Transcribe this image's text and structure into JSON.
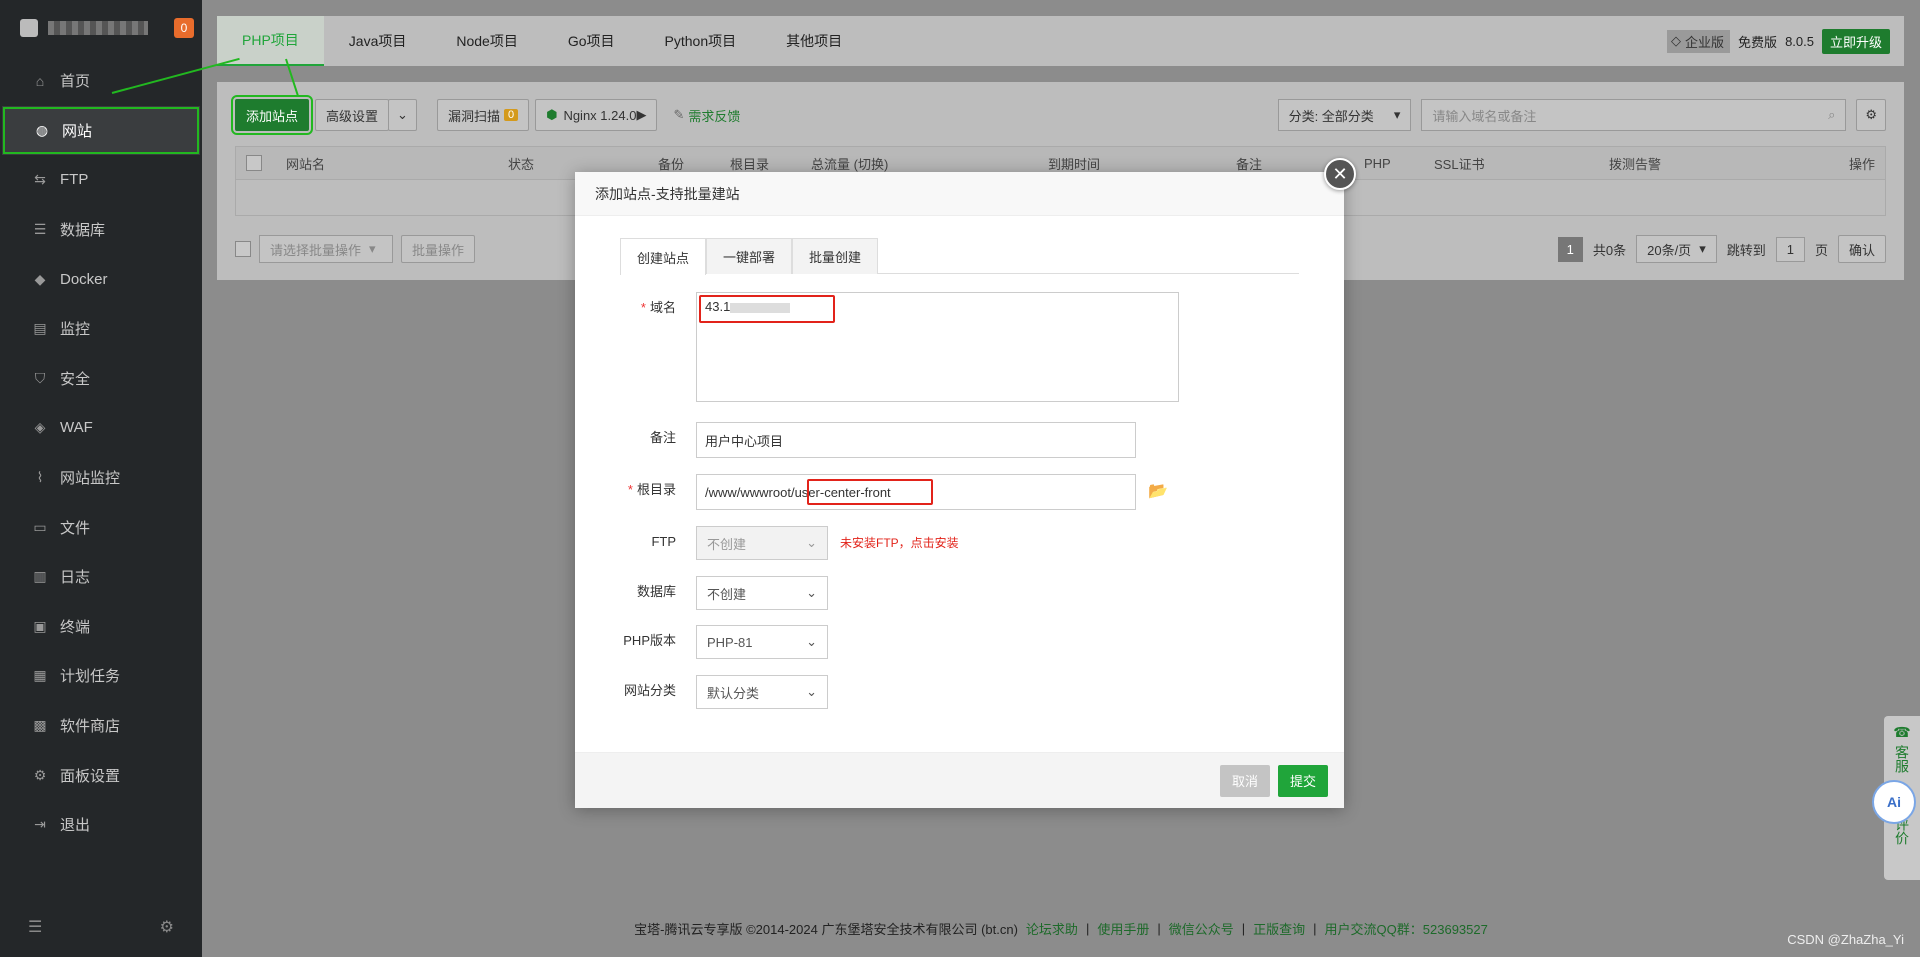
{
  "sidebar": {
    "badge": "0",
    "items": [
      {
        "label": "首页",
        "icon": "home-icon"
      },
      {
        "label": "网站",
        "icon": "globe-icon"
      },
      {
        "label": "FTP",
        "icon": "ftp-icon"
      },
      {
        "label": "数据库",
        "icon": "database-icon"
      },
      {
        "label": "Docker",
        "icon": "docker-icon"
      },
      {
        "label": "监控",
        "icon": "monitor-icon"
      },
      {
        "label": "安全",
        "icon": "shield-icon"
      },
      {
        "label": "WAF",
        "icon": "waf-icon"
      },
      {
        "label": "网站监控",
        "icon": "chart-icon"
      },
      {
        "label": "文件",
        "icon": "folder-icon"
      },
      {
        "label": "日志",
        "icon": "log-icon"
      },
      {
        "label": "终端",
        "icon": "terminal-icon"
      },
      {
        "label": "计划任务",
        "icon": "calendar-icon"
      },
      {
        "label": "软件商店",
        "icon": "apps-icon"
      },
      {
        "label": "面板设置",
        "icon": "gear-icon"
      },
      {
        "label": "退出",
        "icon": "logout-icon"
      }
    ]
  },
  "tabs": [
    "PHP项目",
    "Java项目",
    "Node项目",
    "Go项目",
    "Python项目",
    "其他项目"
  ],
  "header_right": {
    "enterprise": "企业版",
    "free": "免费版",
    "version": "8.0.5",
    "upgrade": "立即升级"
  },
  "toolbar": {
    "add_site": "添加站点",
    "advanced": "高级设置",
    "vuln_scan": "漏洞扫描",
    "vuln_count": "0",
    "nginx": "Nginx 1.24.0",
    "feedback": "需求反馈",
    "category": "分类: 全部分类",
    "search_placeholder": "请输入域名或备注"
  },
  "table": {
    "headers": [
      "网站名",
      "状态",
      "备份",
      "根目录",
      "总流量 (切换)",
      "到期时间",
      "备注",
      "PHP",
      "SSL证书",
      "拨测告警",
      "操作"
    ]
  },
  "pager": {
    "batch_placeholder": "请选择批量操作",
    "batch_btn": "批量操作",
    "page": "1",
    "total": "共0条",
    "per_page": "20条/页",
    "jump": "跳转到",
    "jump_value": "1",
    "page_unit": "页",
    "confirm": "确认"
  },
  "modal": {
    "title": "添加站点-支持批量建站",
    "tabs": [
      "创建站点",
      "一键部署",
      "批量创建"
    ],
    "domain_label": "域名",
    "domain_value": "43.1",
    "remark_label": "备注",
    "remark_value": "用户中心项目",
    "root_label": "根目录",
    "root_prefix": "/www/wwwroot/",
    "root_suffix": "user-center-front",
    "ftp_label": "FTP",
    "ftp_value": "不创建",
    "ftp_warn": "未安装FTP，点击安装",
    "db_label": "数据库",
    "db_value": "不创建",
    "php_label": "PHP版本",
    "php_value": "PHP-81",
    "cat_label": "网站分类",
    "cat_value": "默认分类",
    "cancel": "取消",
    "submit": "提交"
  },
  "footer": {
    "copyright": "宝塔-腾讯云专享版 ©2014-2024 广东堡塔安全技术有限公司 (bt.cn)",
    "links": [
      "论坛求助",
      "使用手册",
      "微信公众号",
      "正版查询",
      "用户交流QQ群：523693527"
    ]
  },
  "float": {
    "service": "客服",
    "rate": "评价",
    "ai": "Ai"
  },
  "watermark": "CSDN @ZhaZha_Yi",
  "colors": {
    "brand_green": "#20a53a",
    "highlight_green": "#22b820",
    "annotation_red": "#e2231a"
  }
}
